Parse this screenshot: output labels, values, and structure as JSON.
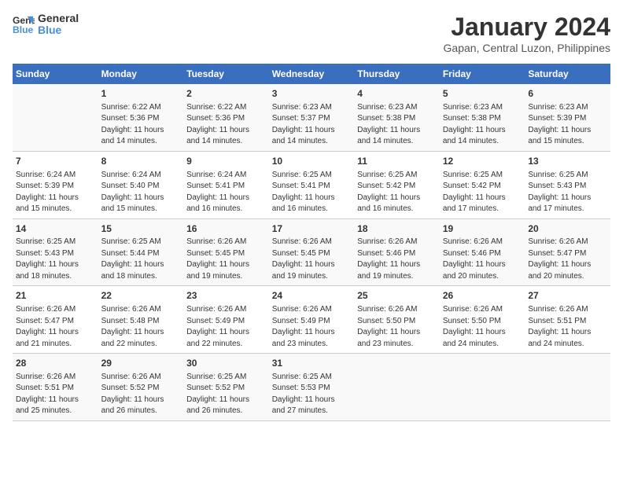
{
  "logo": {
    "line1": "General",
    "line2": "Blue"
  },
  "title": "January 2024",
  "subtitle": "Gapan, Central Luzon, Philippines",
  "days_of_week": [
    "Sunday",
    "Monday",
    "Tuesday",
    "Wednesday",
    "Thursday",
    "Friday",
    "Saturday"
  ],
  "weeks": [
    [
      {
        "day": "",
        "info": ""
      },
      {
        "day": "1",
        "info": "Sunrise: 6:22 AM\nSunset: 5:36 PM\nDaylight: 11 hours\nand 14 minutes."
      },
      {
        "day": "2",
        "info": "Sunrise: 6:22 AM\nSunset: 5:36 PM\nDaylight: 11 hours\nand 14 minutes."
      },
      {
        "day": "3",
        "info": "Sunrise: 6:23 AM\nSunset: 5:37 PM\nDaylight: 11 hours\nand 14 minutes."
      },
      {
        "day": "4",
        "info": "Sunrise: 6:23 AM\nSunset: 5:38 PM\nDaylight: 11 hours\nand 14 minutes."
      },
      {
        "day": "5",
        "info": "Sunrise: 6:23 AM\nSunset: 5:38 PM\nDaylight: 11 hours\nand 14 minutes."
      },
      {
        "day": "6",
        "info": "Sunrise: 6:23 AM\nSunset: 5:39 PM\nDaylight: 11 hours\nand 15 minutes."
      }
    ],
    [
      {
        "day": "7",
        "info": "Sunrise: 6:24 AM\nSunset: 5:39 PM\nDaylight: 11 hours\nand 15 minutes."
      },
      {
        "day": "8",
        "info": "Sunrise: 6:24 AM\nSunset: 5:40 PM\nDaylight: 11 hours\nand 15 minutes."
      },
      {
        "day": "9",
        "info": "Sunrise: 6:24 AM\nSunset: 5:41 PM\nDaylight: 11 hours\nand 16 minutes."
      },
      {
        "day": "10",
        "info": "Sunrise: 6:25 AM\nSunset: 5:41 PM\nDaylight: 11 hours\nand 16 minutes."
      },
      {
        "day": "11",
        "info": "Sunrise: 6:25 AM\nSunset: 5:42 PM\nDaylight: 11 hours\nand 16 minutes."
      },
      {
        "day": "12",
        "info": "Sunrise: 6:25 AM\nSunset: 5:42 PM\nDaylight: 11 hours\nand 17 minutes."
      },
      {
        "day": "13",
        "info": "Sunrise: 6:25 AM\nSunset: 5:43 PM\nDaylight: 11 hours\nand 17 minutes."
      }
    ],
    [
      {
        "day": "14",
        "info": "Sunrise: 6:25 AM\nSunset: 5:43 PM\nDaylight: 11 hours\nand 18 minutes."
      },
      {
        "day": "15",
        "info": "Sunrise: 6:25 AM\nSunset: 5:44 PM\nDaylight: 11 hours\nand 18 minutes."
      },
      {
        "day": "16",
        "info": "Sunrise: 6:26 AM\nSunset: 5:45 PM\nDaylight: 11 hours\nand 19 minutes."
      },
      {
        "day": "17",
        "info": "Sunrise: 6:26 AM\nSunset: 5:45 PM\nDaylight: 11 hours\nand 19 minutes."
      },
      {
        "day": "18",
        "info": "Sunrise: 6:26 AM\nSunset: 5:46 PM\nDaylight: 11 hours\nand 19 minutes."
      },
      {
        "day": "19",
        "info": "Sunrise: 6:26 AM\nSunset: 5:46 PM\nDaylight: 11 hours\nand 20 minutes."
      },
      {
        "day": "20",
        "info": "Sunrise: 6:26 AM\nSunset: 5:47 PM\nDaylight: 11 hours\nand 20 minutes."
      }
    ],
    [
      {
        "day": "21",
        "info": "Sunrise: 6:26 AM\nSunset: 5:47 PM\nDaylight: 11 hours\nand 21 minutes."
      },
      {
        "day": "22",
        "info": "Sunrise: 6:26 AM\nSunset: 5:48 PM\nDaylight: 11 hours\nand 22 minutes."
      },
      {
        "day": "23",
        "info": "Sunrise: 6:26 AM\nSunset: 5:49 PM\nDaylight: 11 hours\nand 22 minutes."
      },
      {
        "day": "24",
        "info": "Sunrise: 6:26 AM\nSunset: 5:49 PM\nDaylight: 11 hours\nand 23 minutes."
      },
      {
        "day": "25",
        "info": "Sunrise: 6:26 AM\nSunset: 5:50 PM\nDaylight: 11 hours\nand 23 minutes."
      },
      {
        "day": "26",
        "info": "Sunrise: 6:26 AM\nSunset: 5:50 PM\nDaylight: 11 hours\nand 24 minutes."
      },
      {
        "day": "27",
        "info": "Sunrise: 6:26 AM\nSunset: 5:51 PM\nDaylight: 11 hours\nand 24 minutes."
      }
    ],
    [
      {
        "day": "28",
        "info": "Sunrise: 6:26 AM\nSunset: 5:51 PM\nDaylight: 11 hours\nand 25 minutes."
      },
      {
        "day": "29",
        "info": "Sunrise: 6:26 AM\nSunset: 5:52 PM\nDaylight: 11 hours\nand 26 minutes."
      },
      {
        "day": "30",
        "info": "Sunrise: 6:25 AM\nSunset: 5:52 PM\nDaylight: 11 hours\nand 26 minutes."
      },
      {
        "day": "31",
        "info": "Sunrise: 6:25 AM\nSunset: 5:53 PM\nDaylight: 11 hours\nand 27 minutes."
      },
      {
        "day": "",
        "info": ""
      },
      {
        "day": "",
        "info": ""
      },
      {
        "day": "",
        "info": ""
      }
    ]
  ]
}
